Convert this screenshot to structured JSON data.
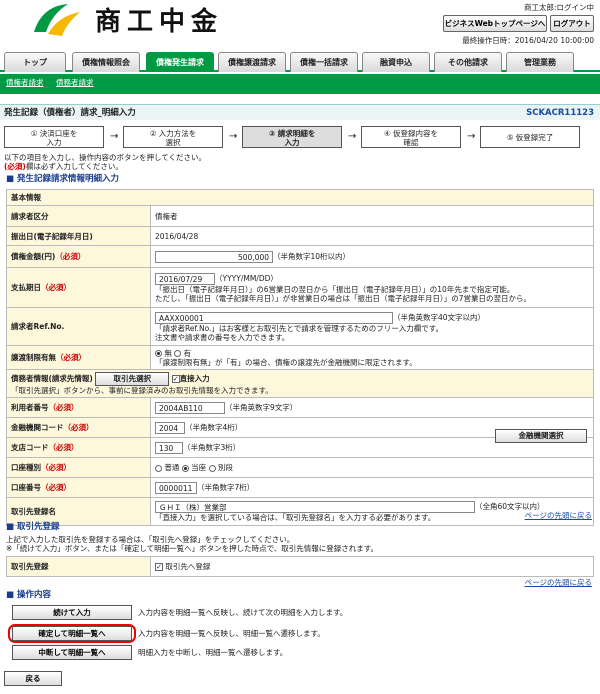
{
  "header": {
    "logo_text": "商工中金",
    "user_name": "商工太郎:ログイン中",
    "top_page_button": "ビジネスWebトップページへ",
    "logout_button": "ログアウト",
    "last_operation": "最終操作日時：2016/04/20 10:00:00"
  },
  "tabs": [
    "トップ",
    "債権情報照会",
    "債権発生請求",
    "債権譲渡請求",
    "債権一括請求",
    "融資申込",
    "その他請求",
    "管理業務"
  ],
  "active_tab": 2,
  "subnav": [
    "債権者請求",
    "債務者請求"
  ],
  "page_title": "発生記録（債権者）請求_明細入力",
  "screen_code": "SCKACR11123",
  "steps": [
    "① 決済口座を\n入力",
    "② 入力方法を\n選択",
    "③ 請求明細を\n入力",
    "④ 仮登録内容を\n確認",
    "⑤ 仮登録完了"
  ],
  "intro_line1": "以下の項目を入力し、操作内容のボタンを押してください。",
  "intro_req": "(必須)",
  "intro_line2": "欄は必ず入力してください。",
  "section1": "発生記録請求情報明細入力",
  "req_mark": "（必須）",
  "form": {
    "basic_info": "基本情報",
    "requester_type_label": "請求者区分",
    "requester_type": "債権者",
    "issue_date_label": "振出日(電子記録年月日)",
    "issue_date": "2016/04/28",
    "amount_label": "債権金額(円)",
    "amount": "500,000",
    "amount_hint": "（半角数字10桁以内）",
    "due_date_label": "支払期日",
    "due_date": "2016/07/29",
    "due_date_hint": "（YYYY/MM/DD）",
    "due_date_note1": "「振出日（電子記録年月日）」の6営業日の翌日から「振出日（電子記録年月日）」の10年先まで指定可能。",
    "due_date_note2": "ただし、「振出日（電子記録年月日）」が非営業日の場合は「振出日（電子記録年月日）」の7営業日の翌日から。",
    "ref_label": "請求者Ref.No.",
    "ref_value": "AAXX00001",
    "ref_hint": "（半角英数字40文字以内）",
    "ref_note1": "「請求者Ref.No.」はお客様とお取引先とで請求を管理するためのフリー入力欄です。",
    "ref_note2": "注文書や請求書の番号を入力できます。",
    "transfer_label": "譲渡制限有無",
    "transfer_none": "無",
    "transfer_yes": "有",
    "transfer_note": "「譲渡制限有無」が「有」の場合、債権の譲渡先が金融機関に限定されます。",
    "debtor_label": "債務者情報(請求先情報)",
    "select_partner_button": "取引先選択",
    "direct_input_label": "直接入力",
    "debtor_note": "「取引先選択」ボタンから、事前に登録済みのお取引先情報を入力できます。",
    "user_no_label": "利用者番号",
    "user_no": "2004AB110",
    "user_no_hint": "（半角英数字9文字）",
    "bank_code_label": "金融機関コード",
    "bank_code": "2004",
    "bank_code_hint": "（半角数字4桁）",
    "bank_select_button": "金融機関選択",
    "branch_code_label": "支店コード",
    "branch_code": "130",
    "branch_code_hint": "（半角数字3桁）",
    "acct_type_label": "口座種別",
    "acct_types": [
      "普通",
      "当座",
      "別段"
    ],
    "acct_no_label": "口座番号",
    "acct_no": "0000011",
    "acct_no_hint": "（半角数字7桁）",
    "partner_name_label": "取引先登録名",
    "partner_name": "ＧＨＩ（株）営業部",
    "partner_name_hint": "（全角60文字以内）",
    "partner_name_note": "「直接入力」を選択している場合は、「取引先登録名」を入力する必要があります。"
  },
  "page_top_link": "ページの先頭に戻る",
  "section2": "取引先登録",
  "section2_desc1": "上記で入力した取引先を登録する場合は、「取引先へ登録」をチェックしてください。",
  "section2_desc2": "※「続けて入力」ボタン、または「確定して明細一覧へ」ボタンを押した時点で、取引先情報に登録されます。",
  "partner_reg_label": "取引先登録",
  "partner_reg_check": "取引先へ登録",
  "section3": "操作内容",
  "ops": [
    {
      "label": "続けて入力",
      "desc": "入力内容を明細一覧へ反映し、続けて次の明細を入力します。"
    },
    {
      "label": "確定して明細一覧へ",
      "desc": "入力内容を明細一覧へ反映し、明細一覧へ遷移します。"
    },
    {
      "label": "中断して明細一覧へ",
      "desc": "明細入力を中断し、明細一覧へ遷移します。"
    }
  ],
  "back_button": "戻る"
}
